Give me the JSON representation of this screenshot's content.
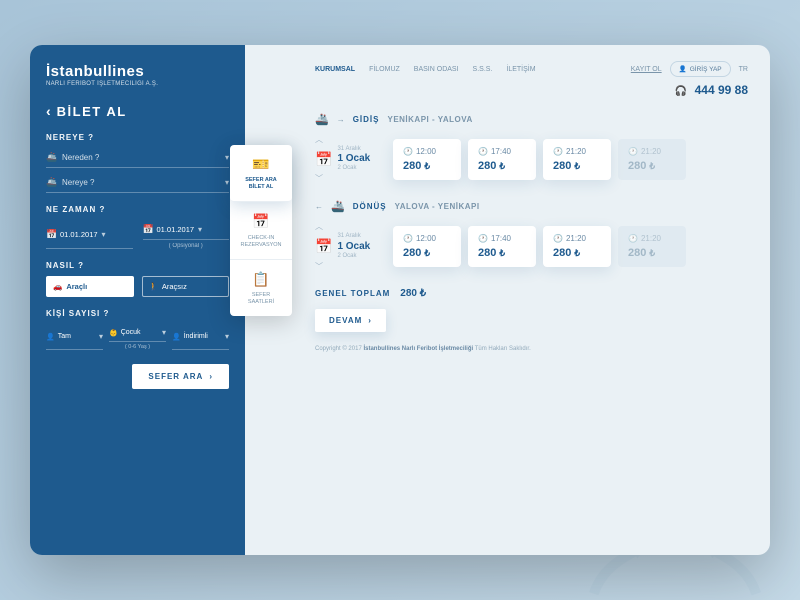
{
  "logo": {
    "name": "İstanbullines",
    "sub": "NARLI FERİBOT İŞLETMECİLİĞİ A.Ş."
  },
  "sidebar": {
    "back_title": "BİLET AL",
    "where_label": "NEREYE ?",
    "from_placeholder": "Nereden ?",
    "to_placeholder": "Nereye ?",
    "when_label": "NE ZAMAN ?",
    "date1": "01.01.2017",
    "date2": "01.01.2017",
    "optional": "( Opsiyonal )",
    "how_label": "NASIL ?",
    "with_vehicle": "Araçlı",
    "without_vehicle": "Araçsız",
    "persons_label": "KİŞİ SAYISI ?",
    "p_full": "Tam",
    "p_child": "Çocuk",
    "p_child_sub": "( 0-6 Yaş )",
    "p_discount": "İndirimli",
    "search_btn": "SEFER ARA"
  },
  "tabs": {
    "t1": "SEFER ARA\nBİLET AL",
    "t2": "CHECK-IN\nREZERVASYON",
    "t3": "SEFER\nSAATLERİ"
  },
  "nav": {
    "corporate": "KURUMSAL",
    "fleet": "FİLOMUZ",
    "press": "BASIN ODASI",
    "faq": "S.S.S.",
    "contact": "İLETİŞİM",
    "signup": "KAYIT OL",
    "login": "GİRİŞ YAP",
    "lang": "TR"
  },
  "phone": "444 99 88",
  "outbound": {
    "label": "GİDİŞ",
    "route": "YENİKAPI - YALOVA",
    "date_prev": "31 Aralık",
    "date_main": "1 Ocak",
    "date_next": "2 Ocak",
    "times": [
      {
        "time": "12:00",
        "price": "280",
        "dim": false
      },
      {
        "time": "17:40",
        "price": "280",
        "dim": false
      },
      {
        "time": "21:20",
        "price": "280",
        "dim": false
      },
      {
        "time": "21:20",
        "price": "280",
        "dim": true
      }
    ]
  },
  "return": {
    "label": "DÖNÜŞ",
    "route": "YALOVA - YENİKAPI",
    "date_prev": "31 Aralık",
    "date_main": "1 Ocak",
    "date_next": "2 Ocak",
    "times": [
      {
        "time": "12:00",
        "price": "280",
        "dim": false
      },
      {
        "time": "17:40",
        "price": "280",
        "dim": false
      },
      {
        "time": "21:20",
        "price": "280",
        "dim": false
      },
      {
        "time": "21:20",
        "price": "280",
        "dim": true
      }
    ]
  },
  "total": {
    "label": "GENEL TOPLAM",
    "value": "280 ₺"
  },
  "continue": "DEVAM",
  "currency": "₺",
  "footer": {
    "copyright": "Copyright © 2017",
    "brand": "İstanbullines Narlı Feribot İşletmeciliği",
    "rights": "Tüm Hakları Saklıdır."
  }
}
